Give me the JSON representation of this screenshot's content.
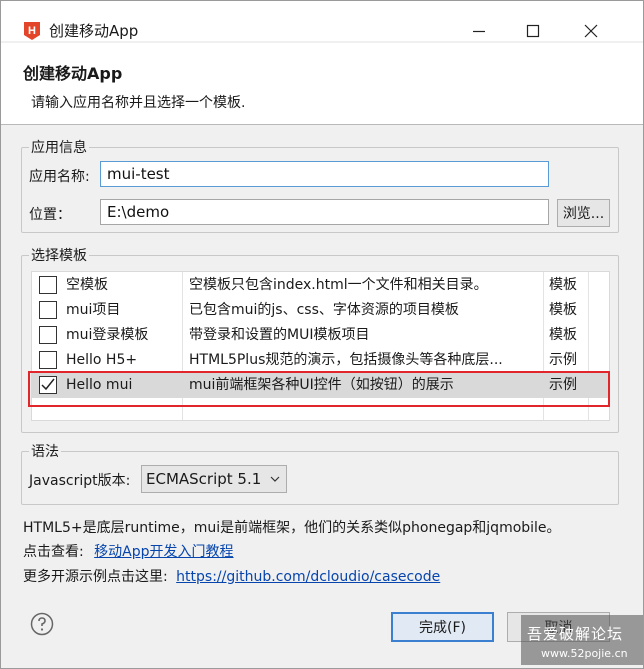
{
  "window": {
    "title": "创建移动App",
    "logo_glyph": "H"
  },
  "header": {
    "title": "创建移动App",
    "description": "请输入应用名称并且选择一个模板."
  },
  "app_info": {
    "group_title": "应用信息",
    "name_label": "应用名称:",
    "name_value": "mui-test",
    "location_label": "位置：",
    "location_value": "E:\\demo",
    "browse_label": "浏览..."
  },
  "templates": {
    "group_title": "选择模板",
    "rows": [
      {
        "checked": false,
        "name": "空模板",
        "description": "空模板只包含index.html一个文件和相关目录。",
        "type": "模板"
      },
      {
        "checked": false,
        "name": "mui项目",
        "description": "已包含mui的js、css、字体资源的项目模板",
        "type": "模板"
      },
      {
        "checked": false,
        "name": "mui登录模板",
        "description": "带登录和设置的MUI模板项目",
        "type": "模板"
      },
      {
        "checked": false,
        "name": "Hello H5+",
        "description": "HTML5Plus规范的演示，包括摄像头等各种底层...",
        "type": "示例"
      },
      {
        "checked": true,
        "name": "Hello mui",
        "description": "mui前端框架各种UI控件（如按钮）的展示",
        "type": "示例"
      }
    ]
  },
  "syntax": {
    "group_title": "语法",
    "js_label": "Javascript版本:",
    "js_value": "ECMAScript 5.1"
  },
  "info": {
    "line1": "HTML5+是底层runtime，mui是前端框架，他们的关系类似phonegap和jqmobile。",
    "line2_prefix": "点击查看:",
    "line2_link": "移动App开发入门教程",
    "line3_prefix": "更多开源示例点击这里:",
    "line3_link": "https://github.com/dcloudio/casecode"
  },
  "buttons": {
    "finish": "完成(F)",
    "cancel": "取消"
  },
  "watermark": {
    "line1": "吾爱破解论坛",
    "line2": "www.52pojie.cn"
  },
  "colors": {
    "highlight_box": "#e0262b",
    "link": "#0645ad",
    "logo": "#e2452a"
  }
}
